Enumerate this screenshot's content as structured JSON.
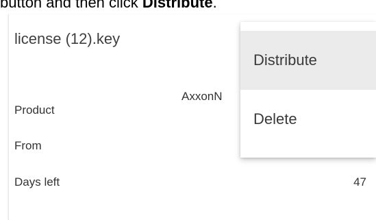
{
  "caption": {
    "text_before": "button and then click ",
    "bold_text": "Distribute",
    "text_after": "."
  },
  "card": {
    "title": "license (12).key",
    "rows": [
      {
        "label": "Product",
        "value": "AxxonN"
      },
      {
        "label": "From",
        "value": ""
      },
      {
        "label": "Days left",
        "value": "47"
      }
    ]
  },
  "context_menu": {
    "items": [
      {
        "label": "Distribute",
        "highlighted": true
      },
      {
        "label": "Delete",
        "highlighted": false
      }
    ]
  }
}
